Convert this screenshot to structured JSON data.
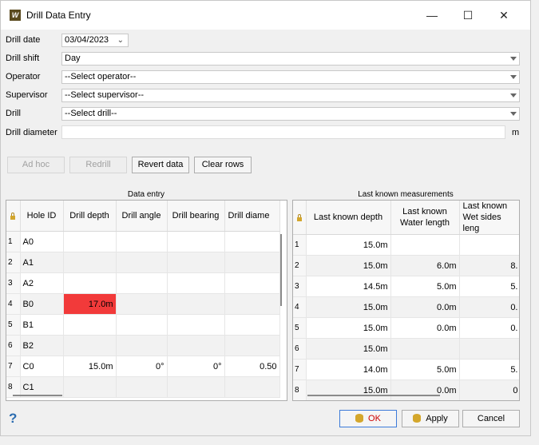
{
  "window": {
    "title": "Drill Data Entry",
    "minimize": "—",
    "maximize": "☐",
    "close": "✕"
  },
  "form": {
    "drill_date_label": "Drill date",
    "drill_date_value": "03/04/2023",
    "drill_shift_label": "Drill shift",
    "drill_shift_value": "Day",
    "operator_label": "Operator",
    "operator_value": "--Select operator--",
    "supervisor_label": "Supervisor",
    "supervisor_value": "--Select supervisor--",
    "drill_label": "Drill",
    "drill_value": "--Select drill--",
    "drill_diameter_label": "Drill diameter",
    "drill_diameter_unit": "m"
  },
  "actions": {
    "ad_hoc": "Ad hoc",
    "redrill": "Redrill",
    "revert": "Revert data",
    "clear_rows": "Clear rows"
  },
  "data_entry": {
    "title": "Data entry",
    "columns": [
      "Hole ID",
      "Drill depth",
      "Drill angle",
      "Drill bearing",
      "Drill diame"
    ],
    "rows": [
      {
        "n": "1",
        "id": "A0",
        "depth": "",
        "angle": "",
        "bearing": "",
        "diam": ""
      },
      {
        "n": "2",
        "id": "A1",
        "depth": "",
        "angle": "",
        "bearing": "",
        "diam": ""
      },
      {
        "n": "3",
        "id": "A2",
        "depth": "",
        "angle": "",
        "bearing": "",
        "diam": ""
      },
      {
        "n": "4",
        "id": "B0",
        "depth": "17.0m",
        "angle": "",
        "bearing": "",
        "diam": ""
      },
      {
        "n": "5",
        "id": "B1",
        "depth": "",
        "angle": "",
        "bearing": "",
        "diam": ""
      },
      {
        "n": "6",
        "id": "B2",
        "depth": "",
        "angle": "",
        "bearing": "",
        "diam": ""
      },
      {
        "n": "7",
        "id": "C0",
        "depth": "15.0m",
        "angle": "0°",
        "bearing": "0°",
        "diam": "0.50"
      },
      {
        "n": "8",
        "id": "C1",
        "depth": "",
        "angle": "",
        "bearing": "",
        "diam": ""
      }
    ]
  },
  "last_known": {
    "title": "Last known measurements",
    "columns": [
      "Last known depth",
      "Last known Water length",
      "Last known Wet sides leng"
    ],
    "rows": [
      {
        "n": "1",
        "depth": "15.0m",
        "water": "",
        "wet": ""
      },
      {
        "n": "2",
        "depth": "15.0m",
        "water": "6.0m",
        "wet": "8."
      },
      {
        "n": "3",
        "depth": "14.5m",
        "water": "5.0m",
        "wet": "5."
      },
      {
        "n": "4",
        "depth": "15.0m",
        "water": "0.0m",
        "wet": "0."
      },
      {
        "n": "5",
        "depth": "15.0m",
        "water": "0.0m",
        "wet": "0."
      },
      {
        "n": "6",
        "depth": "15.0m",
        "water": "",
        "wet": ""
      },
      {
        "n": "7",
        "depth": "14.0m",
        "water": "5.0m",
        "wet": "5."
      },
      {
        "n": "8",
        "depth": "15.0m",
        "water": "0.0m",
        "wet": "0"
      }
    ]
  },
  "footer": {
    "help": "?",
    "ok": "OK",
    "apply": "Apply",
    "cancel": "Cancel"
  },
  "colors": {
    "highlight": "#f23a3a",
    "accent": "#3d7bd9"
  }
}
